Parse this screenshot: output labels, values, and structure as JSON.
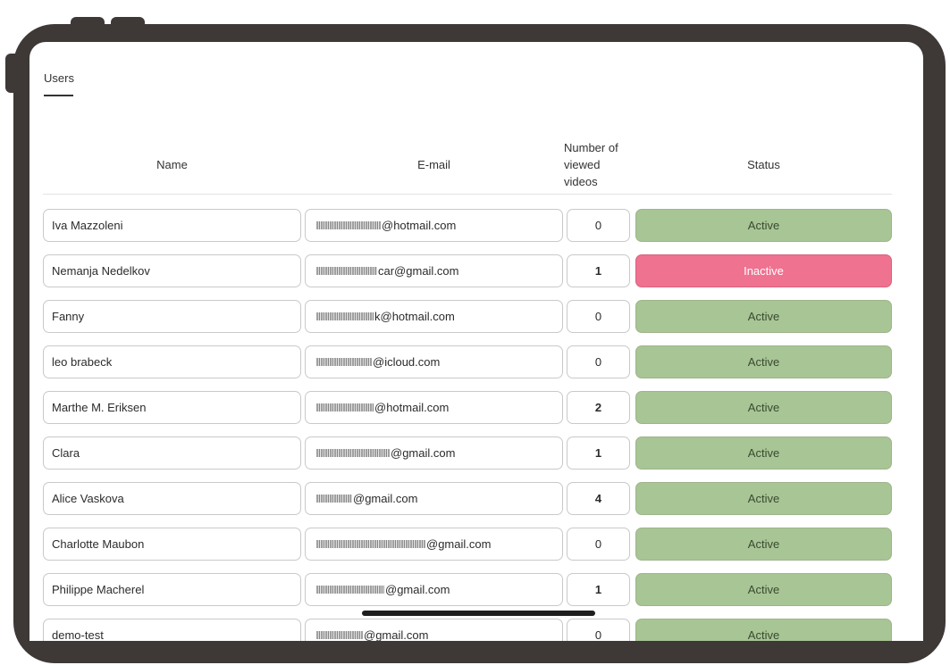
{
  "tabs": {
    "active_label": "Users"
  },
  "table": {
    "headers": {
      "name": "Name",
      "email": "E-mail",
      "videos": "Number of viewed videos",
      "status": "Status"
    },
    "rows": [
      {
        "name": "Iva Mazzoleni",
        "email": "@hotmail.com",
        "videos": "0",
        "status": "Active"
      },
      {
        "name": "Nemanja Nedelkov",
        "email": "car@gmail.com",
        "videos": "1",
        "status": "Inactive"
      },
      {
        "name": "Fanny",
        "email": "k@hotmail.com",
        "videos": "0",
        "status": "Active"
      },
      {
        "name": "leo brabeck",
        "email": "@icloud.com",
        "videos": "0",
        "status": "Active"
      },
      {
        "name": "Marthe M. Eriksen",
        "email": "@hotmail.com",
        "videos": "2",
        "status": "Active"
      },
      {
        "name": "Clara",
        "email": "@gmail.com",
        "videos": "1",
        "status": "Active"
      },
      {
        "name": "Alice Vaskova",
        "email": "@gmail.com",
        "videos": "4",
        "status": "Active"
      },
      {
        "name": "Charlotte Maubon",
        "email": "@gmail.com",
        "videos": "0",
        "status": "Active"
      },
      {
        "name": "Philippe Macherel",
        "email": "@gmail.com",
        "videos": "1",
        "status": "Active"
      },
      {
        "name": "demo-test",
        "email": "@gmail.com",
        "videos": "0",
        "status": "Active"
      }
    ]
  },
  "colors": {
    "frame": "#3e3837",
    "active": "#a8c595",
    "inactive": "#ef7290"
  }
}
